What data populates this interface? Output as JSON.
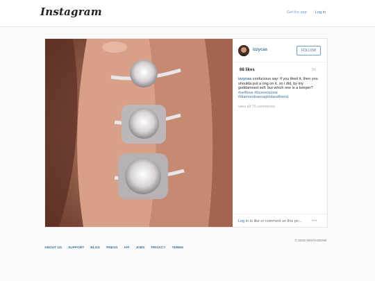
{
  "header": {
    "logo": "Instagram",
    "get_app": "Get the app",
    "login": "Log in"
  },
  "post": {
    "username": "izzycas",
    "follow_label": "FOLLOW",
    "likes": "68 likes",
    "time": "5h",
    "caption_user": "izzycas",
    "caption_text": " confucious say: if you liked it, then you shoulda put a ring on it. so i did, by my goddamned self. but which one is a keeper?",
    "hashtags": [
      "#selflove #foreveralone",
      "#diamondsareagirlsbestfriend"
    ],
    "view_all": "view all 75 comments",
    "login_prompt_link": "Log in",
    "login_prompt_rest": " to like or comment on this po...",
    "more": "•••"
  },
  "footer": {
    "links": [
      "ABOUT US",
      "SUPPORT",
      "BLOG",
      "PRESS",
      "API",
      "JOBS",
      "PRIVACY",
      "TERMS"
    ],
    "copyright": "© 2015 INSTAGRAM"
  }
}
